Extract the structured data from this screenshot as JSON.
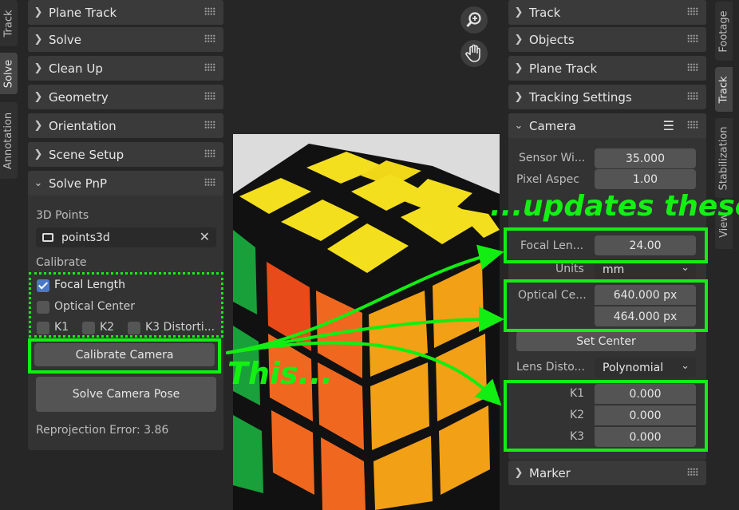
{
  "left_tabs": [
    "Track",
    "Solve",
    "Annotation"
  ],
  "right_tabs": [
    "Footage",
    "Track",
    "Stabilization",
    "View"
  ],
  "left_panels": [
    "Plane Track",
    "Solve",
    "Clean Up",
    "Geometry",
    "Orientation",
    "Scene Setup"
  ],
  "solve_pnp": {
    "title": "Solve PnP",
    "points_label": "3D Points",
    "points_value": "points3d",
    "calibrate_label": "Calibrate",
    "focal_length": "Focal Length",
    "optical_center": "Optical Center",
    "k1": "K1",
    "k2": "K2",
    "k3": "K3 Distorti...",
    "calibrate_button": "Calibrate Camera",
    "solve_button": "Solve Camera Pose",
    "reprojection": "Reprojection Error: 3.86",
    "focal_checked": true
  },
  "right_panels": [
    "Track",
    "Objects",
    "Plane Track",
    "Tracking Settings"
  ],
  "camera": {
    "title": "Camera",
    "sensor_label": "Sensor Wi...",
    "sensor_value": "35.000",
    "pixel_label": "Pixel Aspec",
    "pixel_value": "1.00",
    "focal_label": "Focal Len...",
    "focal_value": "24.00",
    "units_label": "Units",
    "units_value": "mm",
    "optical_label": "Optical Ce...",
    "optical_x": "640.000 px",
    "optical_y": "464.000 px",
    "set_center": "Set Center",
    "lens_label": "Lens Disto...",
    "lens_value": "Polynomial",
    "k1_label": "K1",
    "k1_value": "0.000",
    "k2_label": "K2",
    "k2_value": "0.000",
    "k3_label": "K3",
    "k3_value": "0.000"
  },
  "marker": "Marker",
  "annotations": {
    "this": "This...",
    "updates": "...updates these"
  },
  "colors": {
    "highlight": "#12ee12",
    "checkbox": "#4a78c6"
  }
}
